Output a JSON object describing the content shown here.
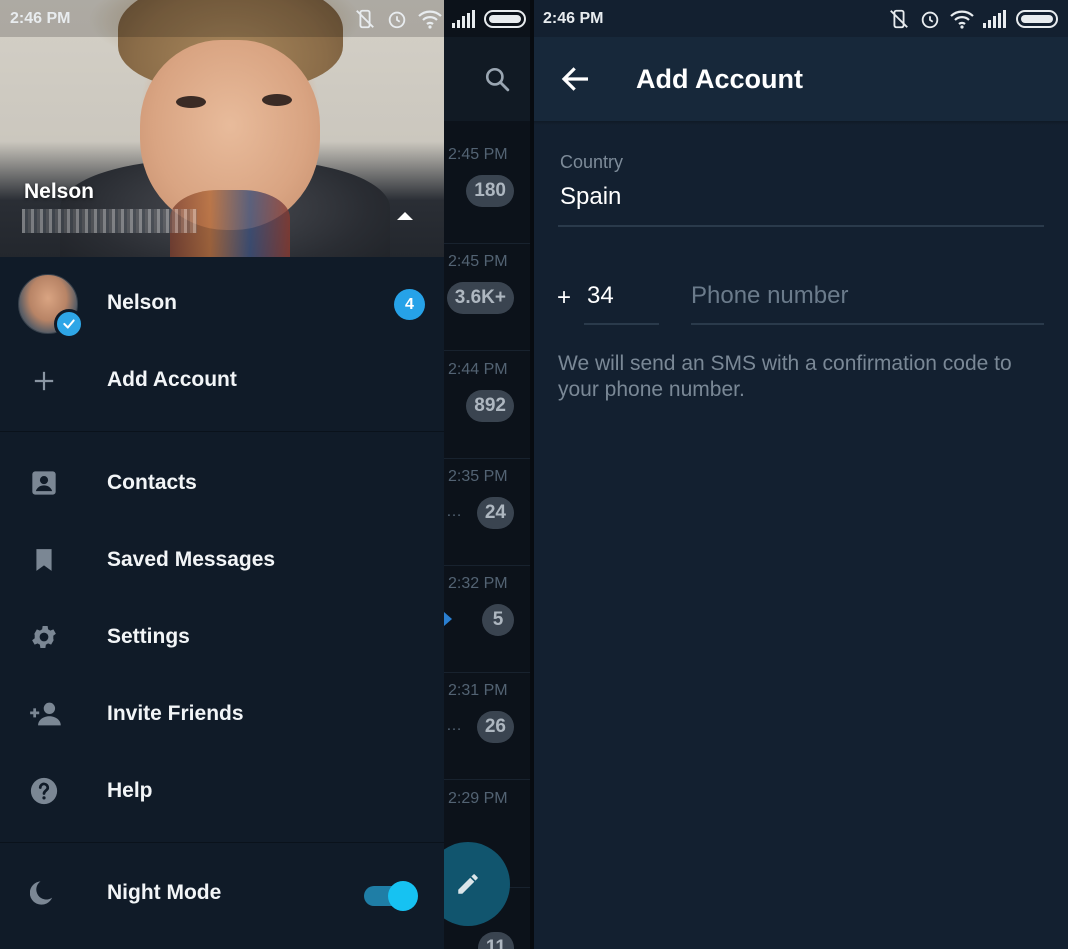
{
  "left_screen": {
    "status_bar": {
      "time": "2:46 PM"
    },
    "drawer": {
      "header": {
        "name": "Nelson"
      },
      "account": {
        "name": "Nelson",
        "unread_count": "4"
      },
      "add_account_label": "Add Account",
      "menu": [
        {
          "label": "Contacts",
          "icon": "contacts-icon"
        },
        {
          "label": "Saved Messages",
          "icon": "bookmark-icon"
        },
        {
          "label": "Settings",
          "icon": "gear-icon"
        },
        {
          "label": "Invite Friends",
          "icon": "add-person-icon"
        },
        {
          "label": "Help",
          "icon": "help-icon"
        }
      ],
      "night_mode": {
        "label": "Night Mode",
        "enabled": true
      }
    },
    "chat_list_peek": [
      {
        "time": "2:45 PM",
        "badge": "180"
      },
      {
        "time": "2:45 PM",
        "badge": "3.6K+"
      },
      {
        "time": "2:44 PM",
        "badge": "892"
      },
      {
        "time": "2:35 PM",
        "badge": "24"
      },
      {
        "time": "2:32 PM",
        "badge": "5"
      },
      {
        "time": "2:31 PM",
        "badge": "26"
      },
      {
        "time": "2:29 PM",
        "badge": ""
      },
      {
        "time": "",
        "badge": "11"
      }
    ]
  },
  "right_screen": {
    "status_bar": {
      "time": "2:46 PM"
    },
    "app_bar": {
      "title": "Add Account"
    },
    "form": {
      "country_label": "Country",
      "country_value": "Spain",
      "plus_sign": "+",
      "country_code": "34",
      "phone_placeholder": "Phone number",
      "hint": "We will send an SMS with a confirmation code to your phone number."
    }
  },
  "colors": {
    "accent": "#2ea6e7",
    "drawer_bg": "#101b28",
    "right_bg": "#132030",
    "appbar_bg": "#17283a"
  }
}
